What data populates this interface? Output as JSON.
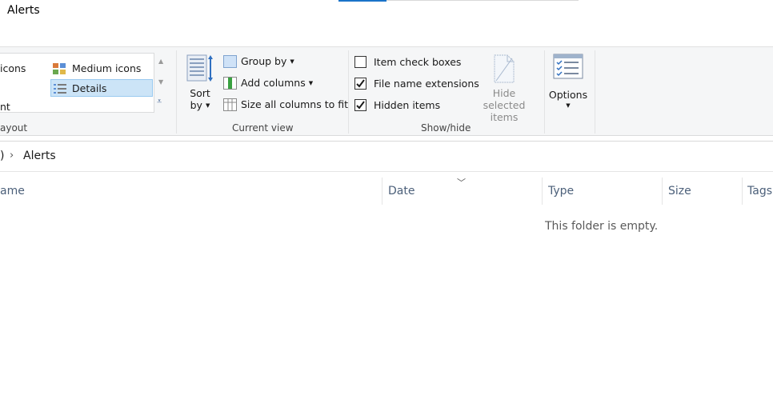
{
  "window": {
    "title": "Alerts"
  },
  "ribbon": {
    "layout": {
      "label": "ayout",
      "items": [
        {
          "label": "icons"
        },
        {
          "label": "Medium icons"
        },
        {
          "label": "Details"
        },
        {
          "label": "nt"
        }
      ]
    },
    "current_view": {
      "label": "Current view",
      "sort_label_line1": "Sort",
      "sort_label_line2": "by",
      "group_by": "Group by",
      "add_columns": "Add columns",
      "size_all_columns": "Size all columns to fit"
    },
    "show_hide": {
      "label": "Show/hide",
      "item_check_boxes": {
        "label": "Item check boxes",
        "checked": false
      },
      "file_name_extensions": {
        "label": "File name extensions",
        "checked": true
      },
      "hidden_items": {
        "label": "Hidden items",
        "checked": true
      },
      "hide_selected_line1": "Hide selected",
      "hide_selected_line2": "items"
    },
    "options": {
      "label": "Options"
    }
  },
  "address": {
    "prev_fragment": ")",
    "current": "Alerts"
  },
  "columns": {
    "name": "ame",
    "date": "Date",
    "type": "Type",
    "size": "Size",
    "tags": "Tags"
  },
  "content": {
    "empty_message": "This folder is empty."
  },
  "colors": {
    "accent": "#1a73c9",
    "selection_bg": "#cce4f7",
    "header_text": "#4c607a"
  }
}
